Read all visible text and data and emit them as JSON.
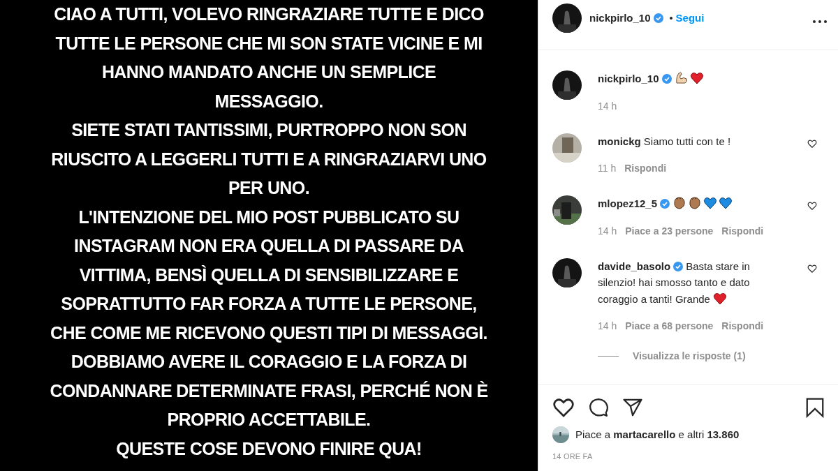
{
  "post_image": {
    "lines": [
      "CIAO A TUTTI, VOLEVO RINGRAZIARE TUTTE E DICO",
      "TUTTE LE PERSONE CHE MI SON STATE VICINE E MI",
      "HANNO MANDATO ANCHE UN SEMPLICE",
      "MESSAGGIO.",
      "SIETE STATI TANTISSIMI, PURTROPPO NON SON",
      "RIUSCITO A LEGGERLI TUTTI E A RINGRAZIARVI UNO",
      "PER UNO.",
      "L'INTENZIONE DEL MIO POST PUBBLICATO SU",
      "INSTAGRAM NON ERA QUELLA DI PASSARE DA",
      "VITTIMA, BENSÌ QUELLA DI SENSIBILIZZARE E",
      "SOPRATTUTTO FAR FORZA A TUTTE LE PERSONE,",
      "CHE COME ME RICEVONO QUESTI TIPI DI MESSAGGI.",
      "DOBBIAMO AVERE IL CORAGGIO E LA FORZA DI",
      "CONDANNARE DETERMINATE FRASI, PERCHÉ NON È",
      "PROPRIO ACCETTABILE.",
      "QUESTE COSE DEVONO FINIRE QUA!"
    ]
  },
  "header": {
    "username": "nickpirlo_10",
    "verified": true,
    "follow": "Segui"
  },
  "comments": [
    {
      "kind": "caption",
      "username": "nickpirlo_10",
      "verified": true,
      "emoji": [
        {
          "kind": "biceps"
        },
        {
          "kind": "red-heart"
        }
      ],
      "time": "14 h"
    },
    {
      "kind": "comment",
      "username": "monickg",
      "verified": false,
      "text": "Siamo tutti con te !",
      "time": "11 h",
      "reply": "Rispondi"
    },
    {
      "kind": "comment",
      "username": "mlopez12_5",
      "verified": true,
      "emoji": [
        {
          "kind": "clap"
        },
        {
          "kind": "clap"
        },
        {
          "kind": "blue-heart"
        },
        {
          "kind": "blue-heart"
        }
      ],
      "time": "14 h",
      "likes": "Piace a 23 persone",
      "reply": "Rispondi"
    },
    {
      "kind": "comment",
      "username": "davide_basolo",
      "verified": true,
      "text": "Basta stare in silenzio! hai smosso tanto e dato coraggio a tanti! Grande",
      "emoji": [
        {
          "kind": "red-heart"
        }
      ],
      "time": "14 h",
      "likes": "Piace a 68 persone",
      "reply": "Rispondi",
      "view_replies": "Visualizza le risposte (1)"
    }
  ],
  "likes": {
    "text": "Piace a **martacarello** e altri **13.860**"
  },
  "timestamp": "14 ORE FA"
}
